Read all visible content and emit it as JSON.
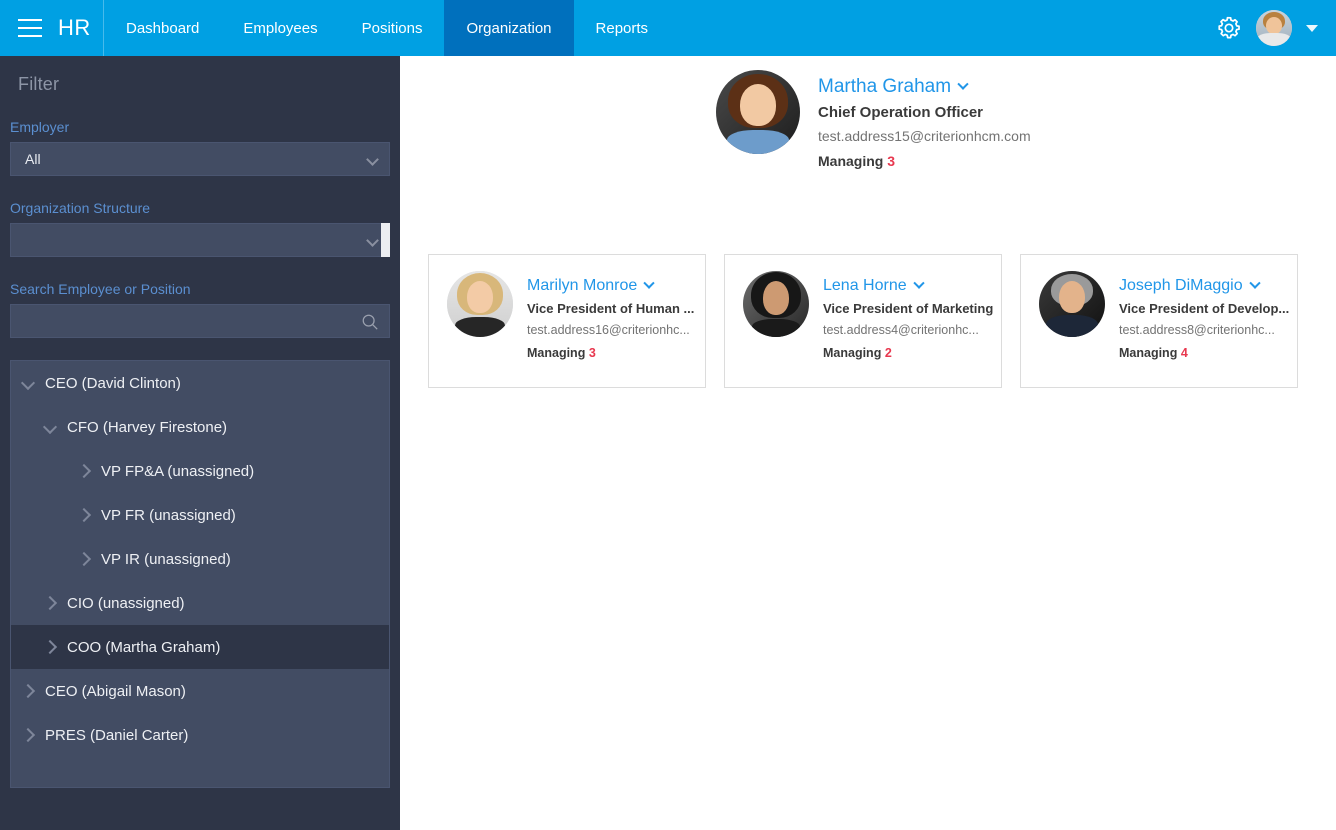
{
  "topbar": {
    "menu_icon": "hamburger-icon",
    "brand": "HR",
    "tabs": [
      {
        "label": "Dashboard",
        "active": false
      },
      {
        "label": "Employees",
        "active": false
      },
      {
        "label": "Positions",
        "active": false
      },
      {
        "label": "Organization",
        "active": true
      },
      {
        "label": "Reports",
        "active": false
      }
    ],
    "settings_icon": "gear-icon",
    "account_icon": "user-avatar",
    "account_caret_icon": "chevron-down-icon",
    "bg_color": "#00a0e3",
    "active_tab_color": "#0070bd"
  },
  "sidebar": {
    "filter_title": "Filter",
    "employer": {
      "label": "Employer",
      "value": "All"
    },
    "org_structure": {
      "label": "Organization Structure",
      "value": ""
    },
    "search": {
      "label": "Search Employee or Position",
      "value": "",
      "placeholder": "",
      "icon": "search-icon"
    },
    "tree": [
      {
        "label": "CEO (David Clinton)",
        "level": 0,
        "expanded": true,
        "selected": false
      },
      {
        "label": "CFO (Harvey Firestone)",
        "level": 1,
        "expanded": true,
        "selected": false
      },
      {
        "label": "VP FP&A (unassigned)",
        "level": 2,
        "expanded": false,
        "selected": false
      },
      {
        "label": "VP FR (unassigned)",
        "level": 2,
        "expanded": false,
        "selected": false
      },
      {
        "label": "VP IR (unassigned)",
        "level": 2,
        "expanded": false,
        "selected": false
      },
      {
        "label": "CIO (unassigned)",
        "level": 1,
        "expanded": false,
        "selected": false
      },
      {
        "label": "COO (Martha Graham)",
        "level": 1,
        "expanded": false,
        "selected": true
      },
      {
        "label": "CEO (Abigail Mason)",
        "level": 0,
        "expanded": false,
        "selected": false
      },
      {
        "label": "PRES (Daniel Carter)",
        "level": 0,
        "expanded": false,
        "selected": false
      }
    ]
  },
  "org_chart": {
    "root": {
      "name": "Martha Graham",
      "title": "Chief Operation Officer",
      "email": "test.address15@criterionhcm.com",
      "managing_label": "Managing",
      "managing_count": "3",
      "caret_icon": "chevron-down-icon",
      "avatar": "photo-martha-graham"
    },
    "children": [
      {
        "name": "Marilyn Monroe",
        "title": "Vice President of Human ...",
        "email": "test.address16@criterionhc...",
        "managing_label": "Managing",
        "managing_count": "3",
        "caret_icon": "chevron-down-icon",
        "avatar": "photo-marilyn-monroe"
      },
      {
        "name": "Lena Horne",
        "title": "Vice President of Marketing",
        "email": "test.address4@criterionhc...",
        "managing_label": "Managing",
        "managing_count": "2",
        "caret_icon": "chevron-down-icon",
        "avatar": "photo-lena-horne"
      },
      {
        "name": "Joseph DiMaggio",
        "title": "Vice President of Develop...",
        "email": "test.address8@criterionhc...",
        "managing_label": "Managing",
        "managing_count": "4",
        "caret_icon": "chevron-down-icon",
        "avatar": "photo-joseph-dimaggio"
      }
    ]
  },
  "colors": {
    "accent_blue": "#00a0e3",
    "active_tab": "#0070bd",
    "link_blue": "#2196e8",
    "sidebar_bg": "#2e3547",
    "panel_bg": "#424c63",
    "label_blue": "#5b8fd0",
    "count_red": "#e8384f"
  }
}
